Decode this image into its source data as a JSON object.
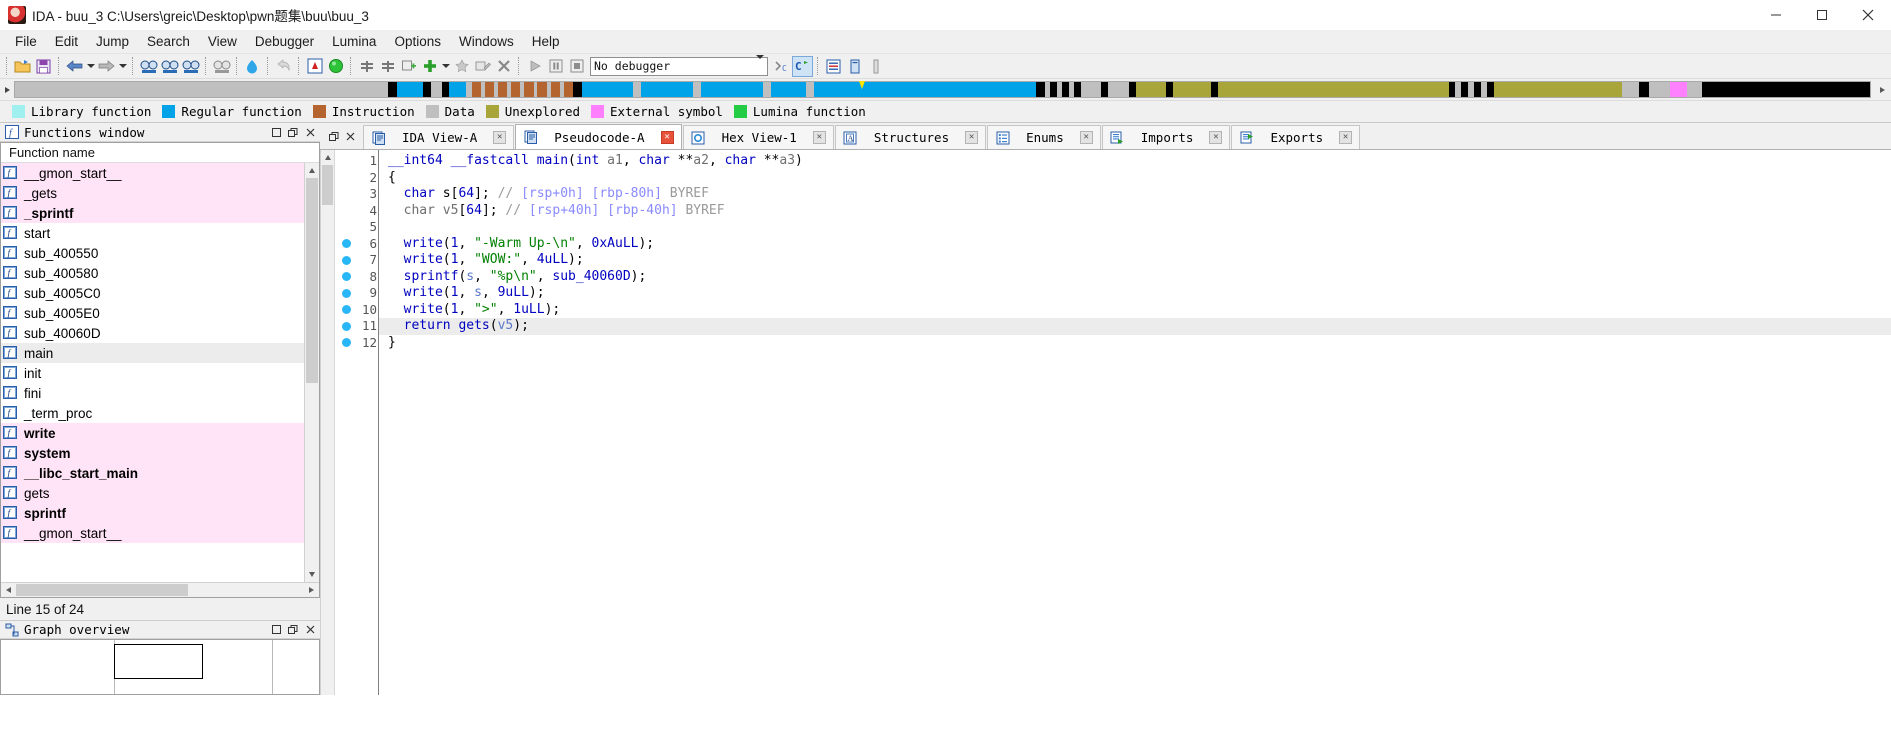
{
  "window": {
    "title": "IDA - buu_3 C:\\Users\\greic\\Desktop\\pwn题集\\buu\\buu_3",
    "app_icon": "ida-logo-icon",
    "minimize": "–",
    "maximize": "☐",
    "close": "✕"
  },
  "menu": {
    "items": [
      {
        "label": "File"
      },
      {
        "label": "Edit"
      },
      {
        "label": "Jump"
      },
      {
        "label": "Search"
      },
      {
        "label": "View"
      },
      {
        "label": "Debugger"
      },
      {
        "label": "Lumina"
      },
      {
        "label": "Options"
      },
      {
        "label": "Windows"
      },
      {
        "label": "Help"
      }
    ]
  },
  "toolbar": {
    "debugger_select_value": "No debugger",
    "icons": [
      "open-file-icon",
      "save-icon",
      "back-arrow-icon",
      "back-dropdown-icon",
      "forward-arrow-icon",
      "forward-dropdown-icon",
      "search-binary-icon",
      "search-text-icon",
      "search-sequence-icon",
      "search-next-icon",
      "color-marker-icon",
      "undo-icon",
      "alt-view-icon",
      "run-to-icon",
      "add-breakpoint-icon",
      "add-breakpoint-2-icon",
      "add-breakpoint-3-icon",
      "plus-green-icon",
      "plus-dropdown-icon",
      "star-icon",
      "edit-function-icon",
      "delete-function-icon",
      "run-icon",
      "pause-icon",
      "stop-icon",
      "debugger-options-icon",
      "reload-icon",
      "open-subviews-icon",
      "strings-icon",
      "segments-icon"
    ]
  },
  "navband": {
    "cursor_position_pct": 45.5,
    "segments": [
      {
        "color": "#bfbfbf",
        "width": 21.8
      },
      {
        "color": "#000000",
        "width": 0.55
      },
      {
        "color": "#00a2e8",
        "width": 1.5
      },
      {
        "color": "#000000",
        "width": 0.5
      },
      {
        "color": "#bfbfbf",
        "width": 0.6
      },
      {
        "color": "#000000",
        "width": 0.45
      },
      {
        "color": "#00a2e8",
        "width": 1.0
      },
      {
        "color": "#bfbfbf",
        "width": 0.3
      },
      {
        "color": "#b4652f",
        "width": 0.55
      },
      {
        "color": "#bfbfbf",
        "width": 0.22
      },
      {
        "color": "#b4652f",
        "width": 0.55
      },
      {
        "color": "#bfbfbf",
        "width": 0.22
      },
      {
        "color": "#b4652f",
        "width": 0.55
      },
      {
        "color": "#bfbfbf",
        "width": 0.22
      },
      {
        "color": "#b4652f",
        "width": 0.55
      },
      {
        "color": "#bfbfbf",
        "width": 0.22
      },
      {
        "color": "#b4652f",
        "width": 0.55
      },
      {
        "color": "#bfbfbf",
        "width": 0.22
      },
      {
        "color": "#b4652f",
        "width": 0.55
      },
      {
        "color": "#bfbfbf",
        "width": 0.22
      },
      {
        "color": "#b4652f",
        "width": 0.55
      },
      {
        "color": "#bfbfbf",
        "width": 0.22
      },
      {
        "color": "#b4652f",
        "width": 0.55
      },
      {
        "color": "#000000",
        "width": 0.5
      },
      {
        "color": "#00a2e8",
        "width": 3.0
      },
      {
        "color": "#bfbfbf",
        "width": 0.5
      },
      {
        "color": "#00a2e8",
        "width": 3.0
      },
      {
        "color": "#bfbfbf",
        "width": 0.5
      },
      {
        "color": "#00a2e8",
        "width": 3.6
      },
      {
        "color": "#bfbfbf",
        "width": 0.5
      },
      {
        "color": "#00a2e8",
        "width": 2.0
      },
      {
        "color": "#bfbfbf",
        "width": 0.5
      },
      {
        "color": "#00a2e8",
        "width": 13.0
      },
      {
        "color": "#000000",
        "width": 0.5
      },
      {
        "color": "#bfbfbf",
        "width": 0.3
      },
      {
        "color": "#000000",
        "width": 0.4
      },
      {
        "color": "#bfbfbf",
        "width": 0.3
      },
      {
        "color": "#000000",
        "width": 0.4
      },
      {
        "color": "#bfbfbf",
        "width": 0.3
      },
      {
        "color": "#000000",
        "width": 0.4
      },
      {
        "color": "#bfbfbf",
        "width": 1.2
      },
      {
        "color": "#000000",
        "width": 0.4
      },
      {
        "color": "#bfbfbf",
        "width": 1.2
      },
      {
        "color": "#000000",
        "width": 0.4
      },
      {
        "color": "#a8a53a",
        "width": 1.8
      },
      {
        "color": "#000000",
        "width": 0.4
      },
      {
        "color": "#a8a53a",
        "width": 2.2
      },
      {
        "color": "#000000",
        "width": 0.4
      },
      {
        "color": "#a8a53a",
        "width": 13.5
      },
      {
        "color": "#000000",
        "width": 0.4
      },
      {
        "color": "#bfbfbf",
        "width": 0.35
      },
      {
        "color": "#000000",
        "width": 0.4
      },
      {
        "color": "#bfbfbf",
        "width": 0.35
      },
      {
        "color": "#000000",
        "width": 0.4
      },
      {
        "color": "#bfbfbf",
        "width": 0.35
      },
      {
        "color": "#000000",
        "width": 0.4
      },
      {
        "color": "#a8a53a",
        "width": 7.5
      },
      {
        "color": "#bfbfbf",
        "width": 1.0
      },
      {
        "color": "#000000",
        "width": 0.6
      },
      {
        "color": "#bfbfbf",
        "width": 1.2
      },
      {
        "color": "#ff80ff",
        "width": 1.0
      },
      {
        "color": "#bfbfbf",
        "width": 0.9
      },
      {
        "color": "#000000",
        "width": 9.8
      }
    ]
  },
  "legend": {
    "items": [
      {
        "label": "Library function",
        "color": "#a0f0f0"
      },
      {
        "label": "Regular function",
        "color": "#00a2e8"
      },
      {
        "label": "Instruction",
        "color": "#b4652f"
      },
      {
        "label": "Data",
        "color": "#bfbfbf"
      },
      {
        "label": "Unexplored",
        "color": "#a8a53a"
      },
      {
        "label": "External symbol",
        "color": "#ff80ff"
      },
      {
        "label": "Lumina function",
        "color": "#22cc44"
      }
    ]
  },
  "functions_panel": {
    "caption": "Functions window",
    "caption_icon": "function-f-icon",
    "caption_buttons": [
      "minimize-panel-icon",
      "float-panel-icon",
      "close-panel-icon"
    ],
    "column_header": "Function name",
    "status": "Line 15 of 24",
    "rows": [
      {
        "name": "__gmon_start__",
        "library": true,
        "bold": false,
        "selected": false
      },
      {
        "name": "_gets",
        "library": true,
        "bold": false,
        "selected": false
      },
      {
        "name": "_sprintf",
        "library": true,
        "bold": true,
        "selected": false
      },
      {
        "name": "start",
        "library": false,
        "bold": false,
        "selected": false
      },
      {
        "name": "sub_400550",
        "library": false,
        "bold": false,
        "selected": false
      },
      {
        "name": "sub_400580",
        "library": false,
        "bold": false,
        "selected": false
      },
      {
        "name": "sub_4005C0",
        "library": false,
        "bold": false,
        "selected": false
      },
      {
        "name": "sub_4005E0",
        "library": false,
        "bold": false,
        "selected": false
      },
      {
        "name": "sub_40060D",
        "library": false,
        "bold": false,
        "selected": false
      },
      {
        "name": "main",
        "library": false,
        "bold": false,
        "selected": true
      },
      {
        "name": "init",
        "library": false,
        "bold": false,
        "selected": false
      },
      {
        "name": "fini",
        "library": false,
        "bold": false,
        "selected": false
      },
      {
        "name": "_term_proc",
        "library": false,
        "bold": false,
        "selected": false
      },
      {
        "name": "write",
        "library": true,
        "bold": true,
        "selected": false
      },
      {
        "name": "system",
        "library": true,
        "bold": true,
        "selected": false
      },
      {
        "name": "__libc_start_main",
        "library": true,
        "bold": true,
        "selected": false
      },
      {
        "name": "gets",
        "library": true,
        "bold": false,
        "selected": false
      },
      {
        "name": "sprintf",
        "library": true,
        "bold": true,
        "selected": false
      },
      {
        "name": "__gmon_start__",
        "library": true,
        "bold": false,
        "selected": false
      }
    ]
  },
  "graph_overview": {
    "caption": "Graph overview",
    "caption_icon": "graph-overview-icon",
    "caption_buttons": [
      "minimize-panel-icon",
      "float-panel-icon",
      "close-panel-icon"
    ]
  },
  "tabs": {
    "prev_icon": "tab-prev-icon",
    "next_icon": "tab-next-icon",
    "close_glyph": "✕",
    "items": [
      {
        "label": "IDA View-A",
        "icon": "ida-view-icon",
        "active": false
      },
      {
        "label": "Pseudocode-A",
        "icon": "pseudocode-icon",
        "active": true
      },
      {
        "label": "Hex View-1",
        "icon": "hex-view-icon",
        "active": false
      },
      {
        "label": "Structures",
        "icon": "structures-icon",
        "active": false
      },
      {
        "label": "Enums",
        "icon": "enums-icon",
        "active": false
      },
      {
        "label": "Imports",
        "icon": "imports-icon",
        "active": false
      },
      {
        "label": "Exports",
        "icon": "exports-icon",
        "active": false
      }
    ]
  },
  "pseudocode": {
    "highlight_line": 11,
    "breakpoint_lines": [
      6,
      7,
      8,
      9,
      10,
      11,
      12
    ],
    "lines": [
      {
        "n": 1,
        "tokens": [
          {
            "t": "__int64 ",
            "c": "typ"
          },
          {
            "t": "__fastcall ",
            "c": "typ"
          },
          {
            "t": "main",
            "c": "fn"
          },
          {
            "t": "(",
            "c": "pun"
          },
          {
            "t": "int ",
            "c": "typ"
          },
          {
            "t": "a1",
            "c": "gidt"
          },
          {
            "t": ", ",
            "c": "pun"
          },
          {
            "t": "char ",
            "c": "typ"
          },
          {
            "t": "**",
            "c": "pun"
          },
          {
            "t": "a2",
            "c": "gidt"
          },
          {
            "t": ", ",
            "c": "pun"
          },
          {
            "t": "char ",
            "c": "typ"
          },
          {
            "t": "**",
            "c": "pun"
          },
          {
            "t": "a3",
            "c": "gidt"
          },
          {
            "t": ")",
            "c": "pun"
          }
        ]
      },
      {
        "n": 2,
        "tokens": [
          {
            "t": "{",
            "c": "pun"
          }
        ]
      },
      {
        "n": 3,
        "tokens": [
          {
            "t": "  ",
            "c": "pun"
          },
          {
            "t": "char ",
            "c": "kw"
          },
          {
            "t": "s",
            "c": "pun"
          },
          {
            "t": "[",
            "c": "pun"
          },
          {
            "t": "64",
            "c": "num"
          },
          {
            "t": "]; ",
            "c": "pun"
          },
          {
            "t": "// ",
            "c": "cmt"
          },
          {
            "t": "[rsp+0h] [rbp-80h]",
            "c": "cmt2"
          },
          {
            "t": " BYREF",
            "c": "cmt"
          }
        ]
      },
      {
        "n": 4,
        "tokens": [
          {
            "t": "  ",
            "c": "pun"
          },
          {
            "t": "char ",
            "c": "gidt"
          },
          {
            "t": "v5",
            "c": "gidt"
          },
          {
            "t": "[",
            "c": "pun"
          },
          {
            "t": "64",
            "c": "num"
          },
          {
            "t": "]; ",
            "c": "pun"
          },
          {
            "t": "// ",
            "c": "cmt"
          },
          {
            "t": "[rsp+40h] [rbp-40h]",
            "c": "cmt2"
          },
          {
            "t": " BYREF",
            "c": "cmt"
          }
        ]
      },
      {
        "n": 5,
        "tokens": []
      },
      {
        "n": 6,
        "tokens": [
          {
            "t": "  ",
            "c": "pun"
          },
          {
            "t": "write",
            "c": "fn"
          },
          {
            "t": "(",
            "c": "pun"
          },
          {
            "t": "1",
            "c": "num"
          },
          {
            "t": ", ",
            "c": "pun"
          },
          {
            "t": "\"-Warm Up-\\n\"",
            "c": "str"
          },
          {
            "t": ", ",
            "c": "pun"
          },
          {
            "t": "0xAuLL",
            "c": "num"
          },
          {
            "t": ");",
            "c": "pun"
          }
        ]
      },
      {
        "n": 7,
        "tokens": [
          {
            "t": "  ",
            "c": "pun"
          },
          {
            "t": "write",
            "c": "fn"
          },
          {
            "t": "(",
            "c": "pun"
          },
          {
            "t": "1",
            "c": "num"
          },
          {
            "t": ", ",
            "c": "pun"
          },
          {
            "t": "\"WOW:\"",
            "c": "str"
          },
          {
            "t": ", ",
            "c": "pun"
          },
          {
            "t": "4uLL",
            "c": "num"
          },
          {
            "t": ");",
            "c": "pun"
          }
        ]
      },
      {
        "n": 8,
        "tokens": [
          {
            "t": "  ",
            "c": "pun"
          },
          {
            "t": "sprintf",
            "c": "fn"
          },
          {
            "t": "(",
            "c": "pun"
          },
          {
            "t": "s",
            "c": "var"
          },
          {
            "t": ", ",
            "c": "pun"
          },
          {
            "t": "\"%p\\n\"",
            "c": "str"
          },
          {
            "t": ", ",
            "c": "pun"
          },
          {
            "t": "sub_40060D",
            "c": "fn"
          },
          {
            "t": ");",
            "c": "pun"
          }
        ]
      },
      {
        "n": 9,
        "tokens": [
          {
            "t": "  ",
            "c": "pun"
          },
          {
            "t": "write",
            "c": "fn"
          },
          {
            "t": "(",
            "c": "pun"
          },
          {
            "t": "1",
            "c": "num"
          },
          {
            "t": ", ",
            "c": "pun"
          },
          {
            "t": "s",
            "c": "var"
          },
          {
            "t": ", ",
            "c": "pun"
          },
          {
            "t": "9uLL",
            "c": "num"
          },
          {
            "t": ");",
            "c": "pun"
          }
        ]
      },
      {
        "n": 10,
        "tokens": [
          {
            "t": "  ",
            "c": "pun"
          },
          {
            "t": "write",
            "c": "fn"
          },
          {
            "t": "(",
            "c": "pun"
          },
          {
            "t": "1",
            "c": "num"
          },
          {
            "t": ", ",
            "c": "pun"
          },
          {
            "t": "\">\"",
            "c": "str"
          },
          {
            "t": ", ",
            "c": "pun"
          },
          {
            "t": "1uLL",
            "c": "num"
          },
          {
            "t": ");",
            "c": "pun"
          }
        ]
      },
      {
        "n": 11,
        "tokens": [
          {
            "t": "  ",
            "c": "pun"
          },
          {
            "t": "return ",
            "c": "kw"
          },
          {
            "t": "gets",
            "c": "fn"
          },
          {
            "t": "(",
            "c": "pun"
          },
          {
            "t": "v5",
            "c": "var"
          },
          {
            "t": ");",
            "c": "pun"
          }
        ]
      },
      {
        "n": 12,
        "tokens": [
          {
            "t": "}",
            "c": "pun"
          }
        ]
      }
    ]
  }
}
